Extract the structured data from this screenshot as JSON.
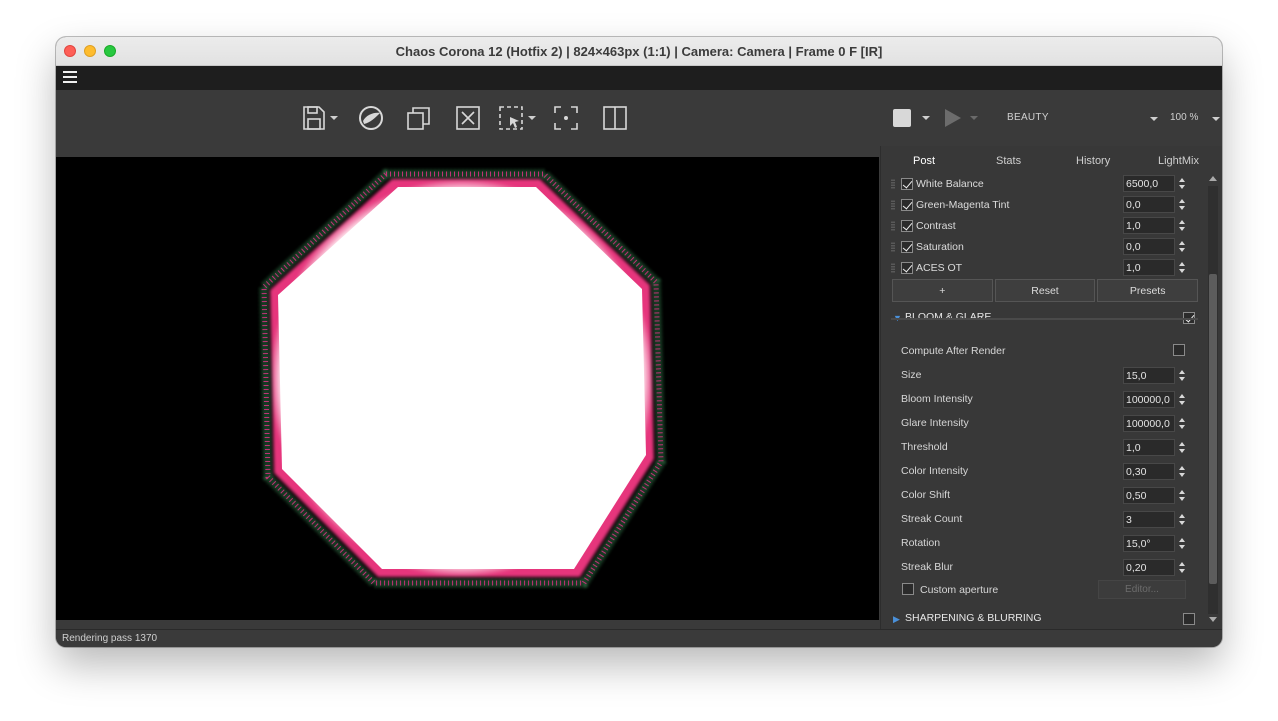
{
  "window": {
    "title": "Chaos Corona 12 (Hotfix 2) | 824×463px (1:1) | Camera: Camera | Frame 0 F [IR]"
  },
  "toolbar": {
    "icons": [
      "save-icon",
      "corona-logo-icon",
      "copy-icon",
      "clear-icon",
      "region-select-icon",
      "focus-pick-icon",
      "compare-icon",
      "stop-icon",
      "play-icon"
    ],
    "render_element": "BEAUTY",
    "zoom": "100 %"
  },
  "viewport": {
    "status": "Rendering pass 1370"
  },
  "panel": {
    "tabs": [
      {
        "label": "Post",
        "active": true
      },
      {
        "label": "Stats",
        "active": false
      },
      {
        "label": "History",
        "active": false
      },
      {
        "label": "LightMix",
        "active": false
      }
    ],
    "operators": [
      {
        "label": "White Balance",
        "value": "6500,0",
        "checked": true
      },
      {
        "label": "Green-Magenta Tint",
        "value": "0,0",
        "checked": true
      },
      {
        "label": "Contrast",
        "value": "1,0",
        "checked": true
      },
      {
        "label": "Saturation",
        "value": "0,0",
        "checked": true
      },
      {
        "label": "ACES OT",
        "value": "1,0",
        "checked": true
      }
    ],
    "buttons": {
      "add": "+",
      "reset": "Reset",
      "presets": "Presets"
    },
    "bloom": {
      "title": "BLOOM & GLARE",
      "enabled": true,
      "compute_after_render": "Compute After Render",
      "props": [
        {
          "label": "Size",
          "value": "15,0"
        },
        {
          "label": "Bloom Intensity",
          "value": "100000,0"
        },
        {
          "label": "Glare Intensity",
          "value": "100000,0"
        },
        {
          "label": "Threshold",
          "value": "1,0"
        },
        {
          "label": "Color Intensity",
          "value": "0,30"
        },
        {
          "label": "Color Shift",
          "value": "0,50"
        },
        {
          "label": "Streak Count",
          "value": "3"
        },
        {
          "label": "Rotation",
          "value": "15,0°"
        },
        {
          "label": "Streak Blur",
          "value": "0,20"
        }
      ],
      "custom_aperture": "Custom aperture",
      "editor": "Editor..."
    },
    "sharpening": {
      "title": "SHARPENING & BLURRING",
      "enabled": false
    }
  },
  "colors": {
    "accent_blue": "#4a90d9",
    "background": "#383838",
    "titlebar": "#e6e6e6"
  }
}
